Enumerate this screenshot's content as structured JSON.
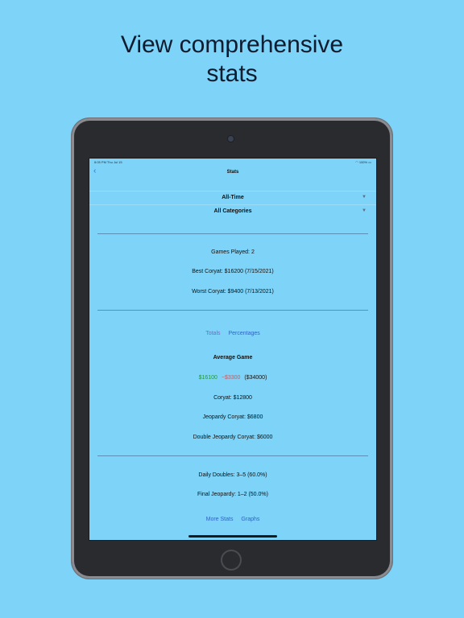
{
  "headline": {
    "line1": "View comprehensive",
    "line2": "stats"
  },
  "statusbar": {
    "time": "8:05 PM  Thu Jul 15",
    "battery": "100%"
  },
  "nav": {
    "title": "Stats"
  },
  "filters": {
    "period": "All-Time",
    "category": "All Categories"
  },
  "summary": {
    "games_played": "Games Played: 2",
    "best": "Best Coryat: $16200 (7/15/2021)",
    "worst": "Worst Coryat: $9400 (7/13/2021)"
  },
  "tabs": {
    "totals": "Totals",
    "percentages": "Percentages"
  },
  "average": {
    "title": "Average Game",
    "positive": "$16100",
    "negative": "−$3300",
    "net": "($34000)",
    "coryat": "Coryat: $12800",
    "jeopardy_coryat": "Jeopardy Coryat: $6800",
    "double_jeopardy_coryat": "Double Jeopardy Coryat: $6000"
  },
  "extras": {
    "daily_doubles": "Daily Doubles: 3–5 (60.0%)",
    "final_jeopardy": "Final Jeopardy: 1–2 (50.0%)",
    "more_stats": "More Stats",
    "graphs": "Graphs"
  }
}
